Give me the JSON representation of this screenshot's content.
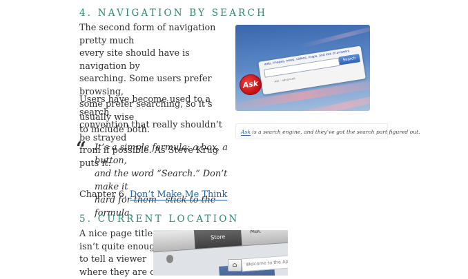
{
  "section4": {
    "heading": "4. NAVIGATION BY SEARCH",
    "para1": [
      "The second form of navigation pretty much",
      "every site should have is navigation by",
      "searching. Some users prefer browsing,",
      "some prefer searching, so it’s usually wise",
      "to include both."
    ],
    "para2": [
      "Users have become used to a search",
      "convention that really shouldn’t be strayed",
      "from if possible. As Steve Krug puts it:"
    ],
    "quote_mark": "“",
    "quote": [
      "It’s a simple formula: a box, a button,",
      "and the word “Search.” Don’t make it",
      "hard for them—stick to the formula."
    ],
    "citation_prefix": "Chapter 6, ",
    "citation_link": "Don’t Make Me Think",
    "figure": {
      "ask_links": "web, images, news, videos, maps, and lots of answers",
      "ask_button": "Search",
      "ask_logo": "Ask",
      "ask_footer": "· Ask · advanced",
      "caption_link": "Ask",
      "caption_text": " is a search engine, and they’ve got the search part figured out."
    }
  },
  "section5": {
    "heading": "5. CURRENT LOCATION",
    "para": [
      "A nice page title",
      "isn’t quite enough",
      "to tell a viewer",
      "where they are on"
    ],
    "figure": {
      "store_tab": "Store",
      "mac_tab": "Mac",
      "welcome_text": "Welcome to the Apple",
      "home_icon": "⌂"
    }
  },
  "colors": {
    "heading": "#2a8a6e",
    "link": "#1e5fa8",
    "text": "#2d2d2d"
  }
}
